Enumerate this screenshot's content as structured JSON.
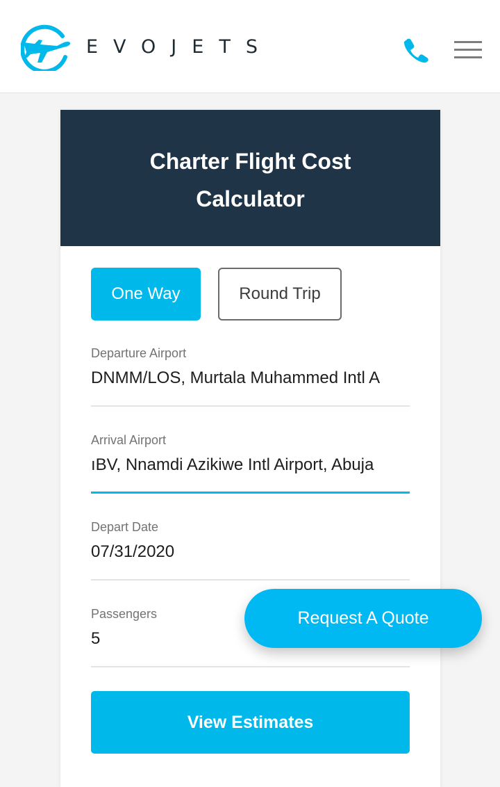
{
  "header": {
    "brand": "EVOJETS",
    "logo_icon": "airplane-logo-icon",
    "phone_icon": "phone-icon",
    "menu_icon": "hamburger-menu-icon"
  },
  "calculator": {
    "title": "Charter Flight Cost Calculator",
    "trip_types": {
      "one_way": "One Way",
      "round_trip": "Round Trip",
      "selected": "One Way"
    },
    "fields": {
      "departure": {
        "label": "Departure Airport",
        "value": "DNMM/LOS, Murtala Muhammed Intl A"
      },
      "arrival": {
        "label": "Arrival Airport",
        "value": "ıBV, Nnamdi Azikiwe Intl Airport, Abuja"
      },
      "date": {
        "label": "Depart Date",
        "value": "07/31/2020"
      },
      "passengers": {
        "label": "Passengers",
        "value": "5"
      }
    },
    "submit_label": "View Estimates"
  },
  "floating": {
    "quote_label": "Request A Quote"
  },
  "colors": {
    "accent": "#00b8e9",
    "header_panel": "#1f3447",
    "background": "#f4f4f4"
  }
}
